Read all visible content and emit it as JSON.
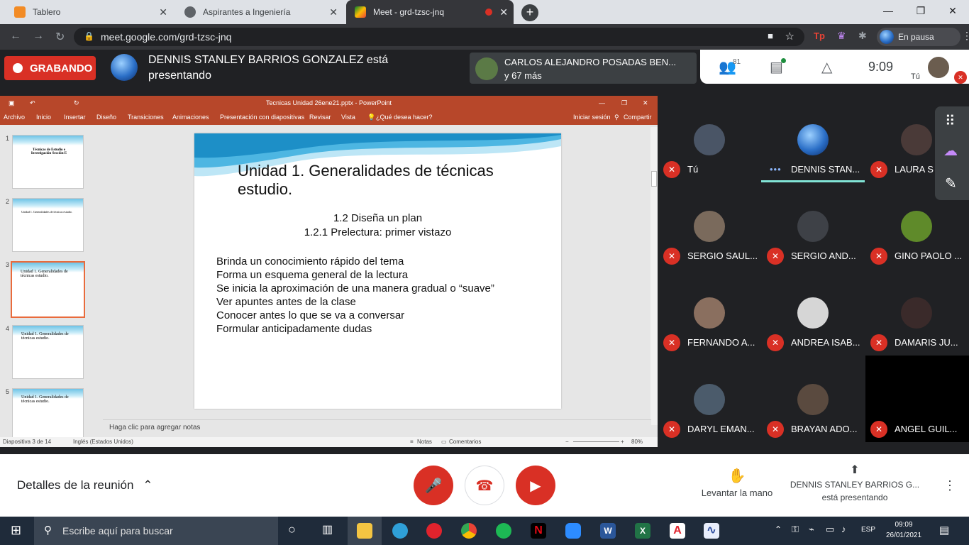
{
  "browser": {
    "tabs": [
      {
        "title": "Tablero",
        "active": false
      },
      {
        "title": "Aspirantes a Ingeniería",
        "active": false
      },
      {
        "title": "Meet - grd-tzsc-jnq",
        "active": true
      }
    ],
    "url": "meet.google.com/grd-tzsc-jnq",
    "profile_label": "En pausa"
  },
  "meet": {
    "recording_label": "GRABANDO",
    "presenter_banner": "DENNIS STANLEY BARRIOS GONZALEZ está presentando",
    "hand_raised": {
      "name": "CARLOS ALEJANDRO POSADAS BEN...",
      "more": "y 67 más"
    },
    "participant_count": "81",
    "time": "9:09",
    "self_label": "Tú",
    "participants": [
      {
        "name": "Tú",
        "muted": true
      },
      {
        "name": "DENNIS STAN...",
        "muted": false
      },
      {
        "name": "LAURA S",
        "muted": true
      },
      {
        "name": "SERGIO SAUL...",
        "muted": true
      },
      {
        "name": "SERGIO AND...",
        "muted": true
      },
      {
        "name": "GINO PAOLO ...",
        "muted": true
      },
      {
        "name": "FERNANDO A...",
        "muted": true
      },
      {
        "name": "ANDREA ISAB...",
        "muted": true
      },
      {
        "name": "DAMARIS JU...",
        "muted": true
      },
      {
        "name": "DARYL EMAN...",
        "muted": true
      },
      {
        "name": "BRAYAN ADO...",
        "muted": true
      },
      {
        "name": "ANGEL GUIL...",
        "muted": true
      }
    ],
    "bottom": {
      "details": "Detalles de la reunión",
      "raise_hand": "Levantar la mano",
      "presenting_name": "DENNIS STANLEY BARRIOS G...",
      "presenting_suffix": "está presentando"
    }
  },
  "powerpoint": {
    "window_title": "Tecnicas Unidad 26ene21.pptx - PowerPoint",
    "ribbon": [
      "Archivo",
      "Inicio",
      "Insertar",
      "Diseño",
      "Transiciones",
      "Animaciones",
      "Presentación con diapositivas",
      "Revisar",
      "Vista",
      "¿Qué desea hacer?"
    ],
    "signin": "Iniciar sesión",
    "share": "Compartir",
    "thumb_numbers": [
      "1",
      "2",
      "3",
      "4",
      "5"
    ],
    "thumb1_title": "Técnicas de Estudio e Investigación Sección E",
    "thumb_titles": [
      "Unidad 1. Generalidades de técnicas estudio."
    ],
    "slide": {
      "title": "Unidad 1. Generalidades de técnicas estudio.",
      "subtitle1": "1.2 Diseña un plan",
      "subtitle2": "1.2.1 Prelectura: primer vistazo",
      "bullets": [
        "Brinda un conocimiento rápido del tema",
        "Forma un esquema general de la lectura",
        "Se inicia la aproximación de una manera gradual o “suave”",
        "Ver apuntes antes de la clase",
        "Conocer antes lo que se va a conversar",
        "Formular anticipadamente dudas"
      ]
    },
    "notes_placeholder": "Haga clic para agregar notas",
    "status": {
      "slide_info": "Diapositiva 3 de 14",
      "language": "Inglés (Estados Unidos)",
      "notes": "Notas",
      "comments": "Comentarios",
      "zoom": "80%"
    }
  },
  "taskbar": {
    "search_placeholder": "Escribe aquí para buscar",
    "lang": "ESP",
    "time": "09:09",
    "date": "26/01/2021"
  },
  "colors": {
    "meet_red": "#d93025",
    "ppt_orange": "#b7472a",
    "meet_dark": "#202124"
  }
}
